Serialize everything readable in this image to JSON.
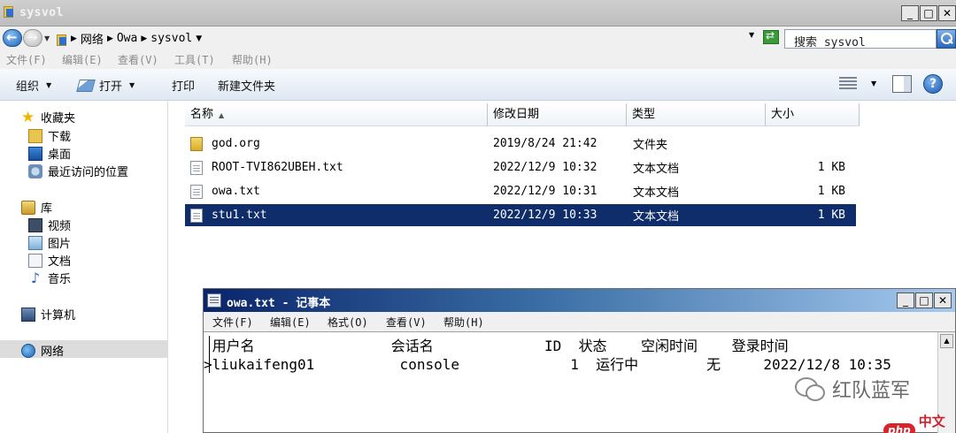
{
  "explorer": {
    "title": "sysvol",
    "breadcrumb": [
      "网络",
      "Owa",
      "sysvol"
    ],
    "search_placeholder": "搜索 sysvol",
    "menu": [
      "文件(F)",
      "编辑(E)",
      "查看(V)",
      "工具(T)",
      "帮助(H)"
    ],
    "toolbar": {
      "organize": "组织",
      "open": "打开",
      "print": "打印",
      "new_folder": "新建文件夹"
    },
    "nav": {
      "favorites": "收藏夹",
      "downloads": "下载",
      "desktop": "桌面",
      "recent": "最近访问的位置",
      "libraries": "库",
      "videos": "视频",
      "pictures": "图片",
      "documents": "文档",
      "music": "音乐",
      "computer": "计算机",
      "network": "网络"
    },
    "columns": {
      "name": "名称",
      "modified": "修改日期",
      "type": "类型",
      "size": "大小"
    },
    "files": [
      {
        "name": "god.org",
        "modified": "2019/8/24 21:42",
        "type": "文件夹",
        "size": "",
        "icon": "folder-icon"
      },
      {
        "name": "ROOT-TVI862UBEH.txt",
        "modified": "2022/12/9 10:32",
        "type": "文本文档",
        "size": "1 KB",
        "icon": "text-file-icon"
      },
      {
        "name": "owa.txt",
        "modified": "2022/12/9 10:31",
        "type": "文本文档",
        "size": "1 KB",
        "icon": "text-file-icon"
      },
      {
        "name": "stu1.txt",
        "modified": "2022/12/9 10:33",
        "type": "文本文档",
        "size": "1 KB",
        "icon": "text-file-icon"
      }
    ],
    "selected_file": "stu1.txt"
  },
  "notepad": {
    "title": "owa.txt - 记事本",
    "menu": [
      "文件(F)",
      "编辑(E)",
      "格式(O)",
      "查看(V)",
      "帮助(H)"
    ],
    "lines": [
      " 用户名                会话名             ID  状态    空闲时间    登录时间",
      ">liukaifeng01          console             1  运行中        无     2022/12/8 10:35"
    ]
  },
  "watermarks": {
    "wechat": "红队蓝军",
    "php_badge": "php",
    "php_site": "中文网"
  },
  "colors": {
    "selection": "#0f2d6b",
    "notepad_title_start": "#0a246a",
    "notepad_title_end": "#a6caf0"
  }
}
